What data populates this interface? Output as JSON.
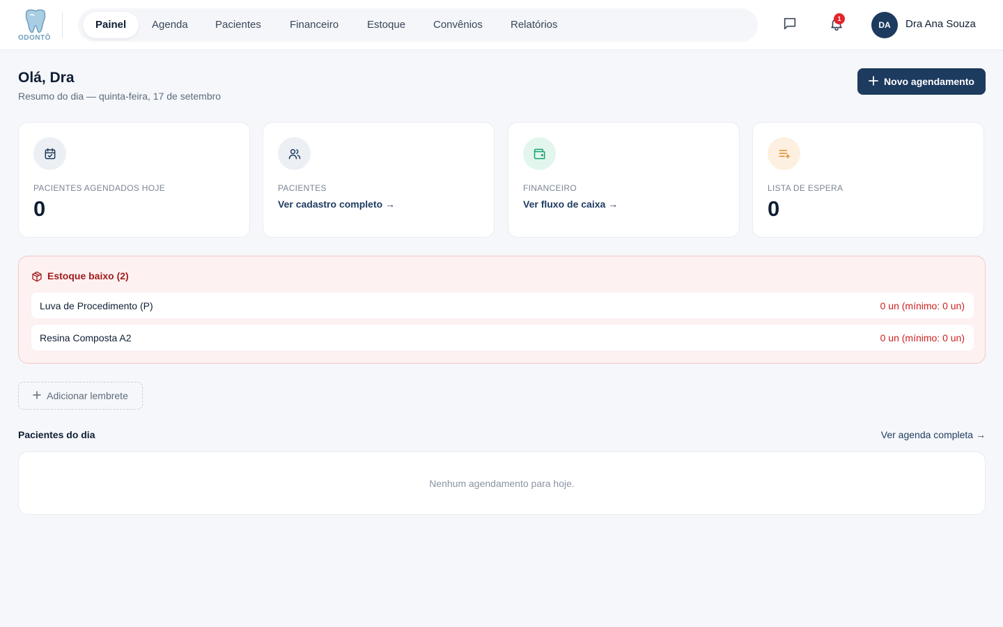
{
  "app": {
    "logo_text": "ODONTÔ"
  },
  "nav": {
    "items": [
      {
        "label": "Painel",
        "active": true
      },
      {
        "label": "Agenda"
      },
      {
        "label": "Pacientes"
      },
      {
        "label": "Financeiro"
      },
      {
        "label": "Estoque"
      },
      {
        "label": "Convênios"
      },
      {
        "label": "Relatórios"
      }
    ]
  },
  "header": {
    "chat_icon": "message-square-icon",
    "bell_icon": "bell-icon",
    "notification_count": "1",
    "avatar_initials": "DA",
    "user_name": "Dra Ana Souza"
  },
  "greeting": {
    "title": "Olá, Dra",
    "subtitle": "Resumo do dia — quinta-feira, 17 de setembro"
  },
  "actions": {
    "new_appointment_label": "Novo agendamento"
  },
  "cards": [
    {
      "icon": "calendar-check-icon",
      "label": "PACIENTES AGENDADOS HOJE",
      "value": "0",
      "icon_bg": "#eceff3",
      "icon_color": "#1d3a5f"
    },
    {
      "icon": "users-icon",
      "label": "PACIENTES",
      "link": "Ver cadastro completo →",
      "icon_bg": "#eceff3",
      "icon_color": "#1d3a5f"
    },
    {
      "icon": "wallet-icon",
      "label": "FINANCEIRO",
      "link": "Ver fluxo de caixa →",
      "icon_bg": "#e3f6ee",
      "icon_color": "#15a36b"
    },
    {
      "icon": "list-plus-icon",
      "label": "LISTA DE ESPERA",
      "value": "0",
      "icon_bg": "#fdf0e0",
      "icon_color": "#e0892a"
    }
  ],
  "low_stock": {
    "title": "Estoque baixo (2)",
    "items": [
      {
        "name": "Luva de Procedimento (P)",
        "qty": "0 un (mínimo: 0 un)"
      },
      {
        "name": "Resina Composta A2",
        "qty": "0 un (mínimo: 0 un)"
      }
    ]
  },
  "reminder": {
    "label": "Adicionar lembrete"
  },
  "patients_today": {
    "title": "Pacientes do dia",
    "link": "Ver agenda completa →",
    "empty": "Nenhum agendamento para hoje."
  },
  "colors": {
    "primary": "#1d3a5f",
    "danger": "#cc1e1e",
    "background": "#f5f7fa"
  }
}
